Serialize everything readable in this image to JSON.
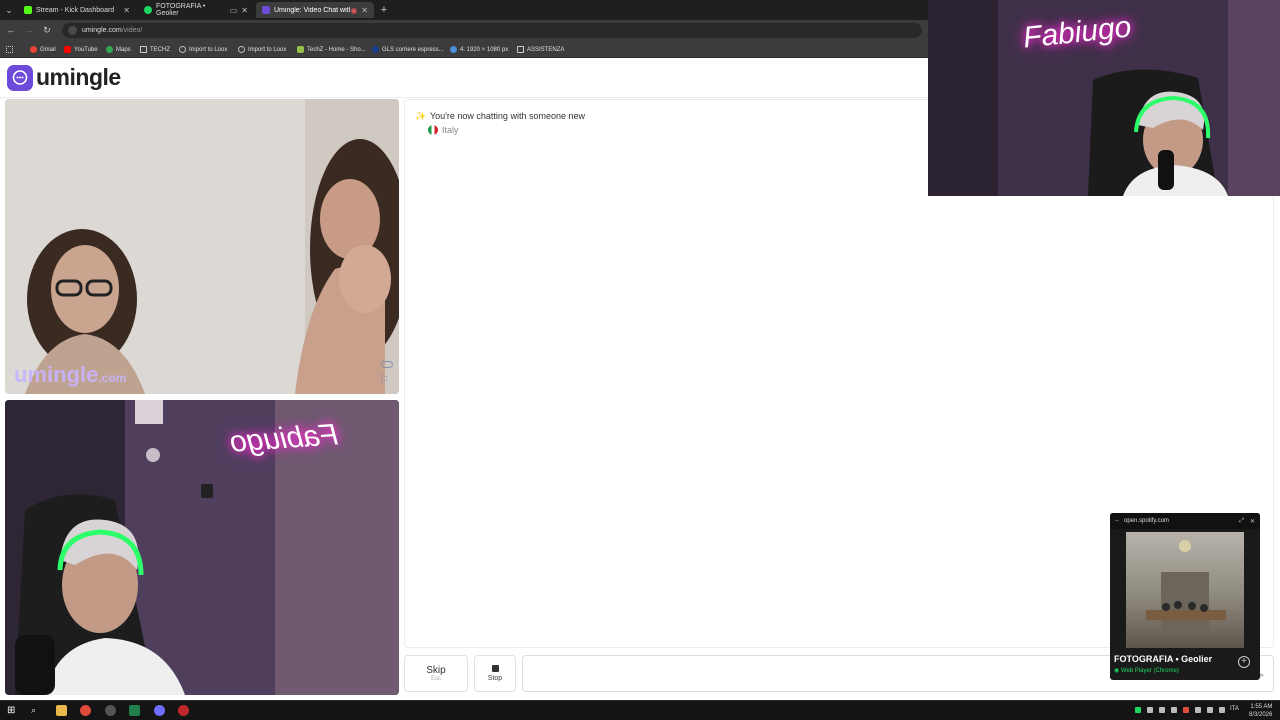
{
  "browser": {
    "tabs": [
      {
        "title": "Stream - Kick Dashboard",
        "favicon_color": "#53fc18"
      },
      {
        "title": "FOTOGRAFIA • Geolier",
        "favicon_color": "#1ed760"
      },
      {
        "title": "Umingle: Video Chat with S",
        "favicon_color": "#6d4bd8"
      }
    ],
    "new_tab_icon": "plus-icon",
    "url_host": "umingle.com",
    "url_path": "/video/",
    "bookmarks": [
      {
        "label": "Gmail",
        "color": "#ea4335"
      },
      {
        "label": "YouTube",
        "color": "#ff0000"
      },
      {
        "label": "Maps",
        "color": "#34a853"
      },
      {
        "label": "TECHZ",
        "color": "#e0e0e0"
      },
      {
        "label": "Import to Loox",
        "color": "#bdbdbd"
      },
      {
        "label": "Import to Loox",
        "color": "#bdbdbd"
      },
      {
        "label": "TechZ - Home - Sho...",
        "color": "#96bf48"
      },
      {
        "label": "GLS corriere espress...",
        "color": "#1a3c8f"
      },
      {
        "label": "4: 1920 × 1080 px",
        "color": "#4a90d9"
      },
      {
        "label": "ASSISTENZA",
        "color": "#e0e0e0"
      }
    ]
  },
  "site": {
    "logo_text": "umingle",
    "watermark_main": "umingle",
    "watermark_suffix": ".com",
    "accent": "#6d4bd8"
  },
  "chat": {
    "status_message": "You're now chatting with someone new",
    "country": "Italy"
  },
  "controls": {
    "skip_label": "Skip",
    "skip_hint": "Esc",
    "stop_label": "Stop"
  },
  "overlay": {
    "neon_text": "Fabiugo"
  },
  "spotify": {
    "host": "open.spotify.com",
    "track": "FOTOGRAFIA • Geolier",
    "device": "Web Player (Chrome)"
  },
  "taskbar": {
    "time": "1:55 AM",
    "date": "8/3/2026",
    "lang": "ITA"
  }
}
